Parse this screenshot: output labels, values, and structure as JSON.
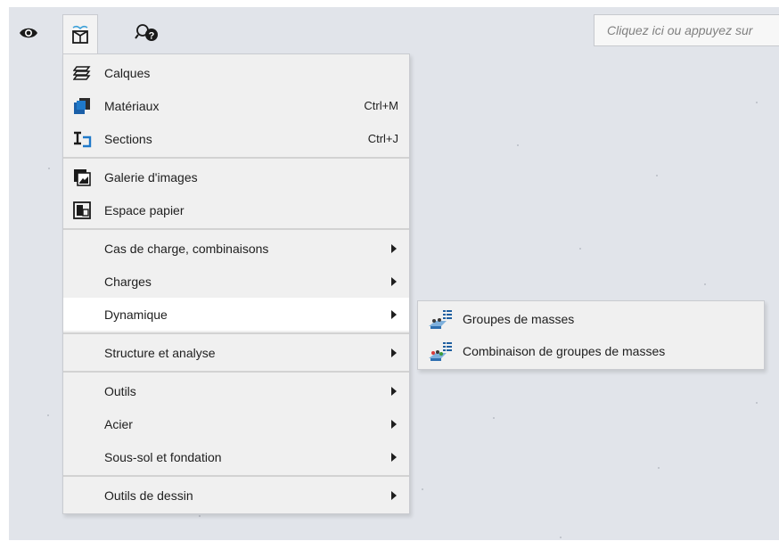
{
  "toolbar": {
    "eye_icon": "eye-icon",
    "main_icon": "menu-book-icon",
    "help_icon": "help-search-icon",
    "command_placeholder": "Cliquez ici ou appuyez sur"
  },
  "menu": {
    "groups": [
      [
        {
          "label": "Calques",
          "shortcut": "",
          "icon": "layers-icon"
        },
        {
          "label": "Matériaux",
          "shortcut": "Ctrl+M",
          "icon": "materials-icon"
        },
        {
          "label": "Sections",
          "shortcut": "Ctrl+J",
          "icon": "sections-icon"
        }
      ],
      [
        {
          "label": "Galerie d'images",
          "shortcut": "",
          "icon": "image-gallery-icon"
        },
        {
          "label": "Espace papier",
          "shortcut": "",
          "icon": "paper-space-icon"
        }
      ],
      [
        {
          "label": "Cas de charge, combinaisons",
          "submenu": true
        },
        {
          "label": "Charges",
          "submenu": true
        },
        {
          "label": "Dynamique",
          "submenu": true,
          "highlighted": true
        }
      ],
      [
        {
          "label": "Structure et analyse",
          "submenu": true
        }
      ],
      [
        {
          "label": "Outils",
          "submenu": true
        },
        {
          "label": "Acier",
          "submenu": true
        },
        {
          "label": "Sous-sol et fondation",
          "submenu": true
        }
      ],
      [
        {
          "label": "Outils de dessin",
          "submenu": true
        }
      ]
    ]
  },
  "submenu": {
    "items": [
      {
        "label": "Groupes de masses",
        "icon": "mass-groups-icon"
      },
      {
        "label": "Combinaison de groupes de masses",
        "icon": "mass-group-combination-icon"
      }
    ]
  },
  "colors": {
    "canvas": "#e1e4ea",
    "menu_bg": "#f0f0f0",
    "highlight": "#ffffff"
  }
}
